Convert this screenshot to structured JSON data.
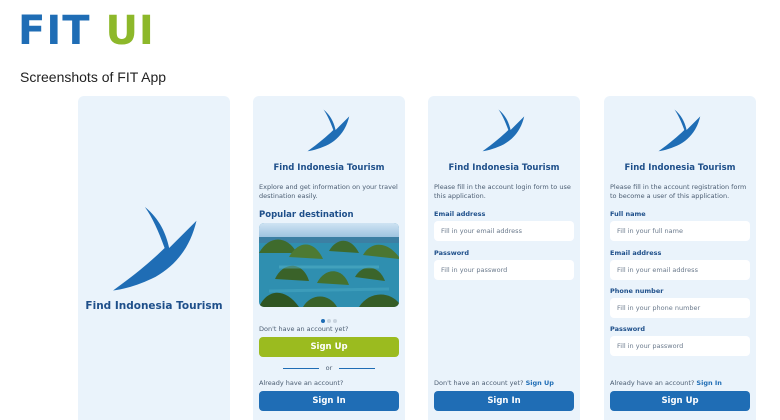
{
  "header": {
    "brand_part1": "FIT",
    "brand_part2": "UI",
    "subtitle": "Screenshots of FIT App"
  },
  "colors": {
    "primary_blue": "#1f6db5",
    "accent_green": "#9bbb1f",
    "screen_bg": "#eaf3fb"
  },
  "splash": {
    "app_name": "Find Indonesia Tourism"
  },
  "welcome": {
    "app_name": "Find Indonesia Tourism",
    "description": "Explore and get information on your travel destination easily.",
    "section_title": "Popular destination",
    "carousel": {
      "total": 3,
      "active": 1
    },
    "no_account_text": "Don't have an account yet?",
    "signup_label": "Sign Up",
    "or_label": "or",
    "have_account_text": "Already have an account?",
    "signin_label": "Sign In"
  },
  "login": {
    "app_name": "Find Indonesia Tourism",
    "description": "Please fill in the account login form to use this application.",
    "email_label": "Email address",
    "email_placeholder": "Fill in your email address",
    "password_label": "Password",
    "password_placeholder": "Fill in your password",
    "no_account_text": "Don't have an account yet?",
    "signup_link": "Sign Up",
    "signin_label": "Sign In"
  },
  "register": {
    "app_name": "Find Indonesia Tourism",
    "description": "Please fill in the account registration form to become a user of this application.",
    "fullname_label": "Full name",
    "fullname_placeholder": "Fill in your full name",
    "email_label": "Email address",
    "email_placeholder": "Fill in your email address",
    "phone_label": "Phone number",
    "phone_placeholder": "Fill in your phone number",
    "password_label": "Password",
    "password_placeholder": "Fill in your password",
    "have_account_text": "Already have an account?",
    "signin_link": "Sign In",
    "signup_label": "Sign Up"
  }
}
